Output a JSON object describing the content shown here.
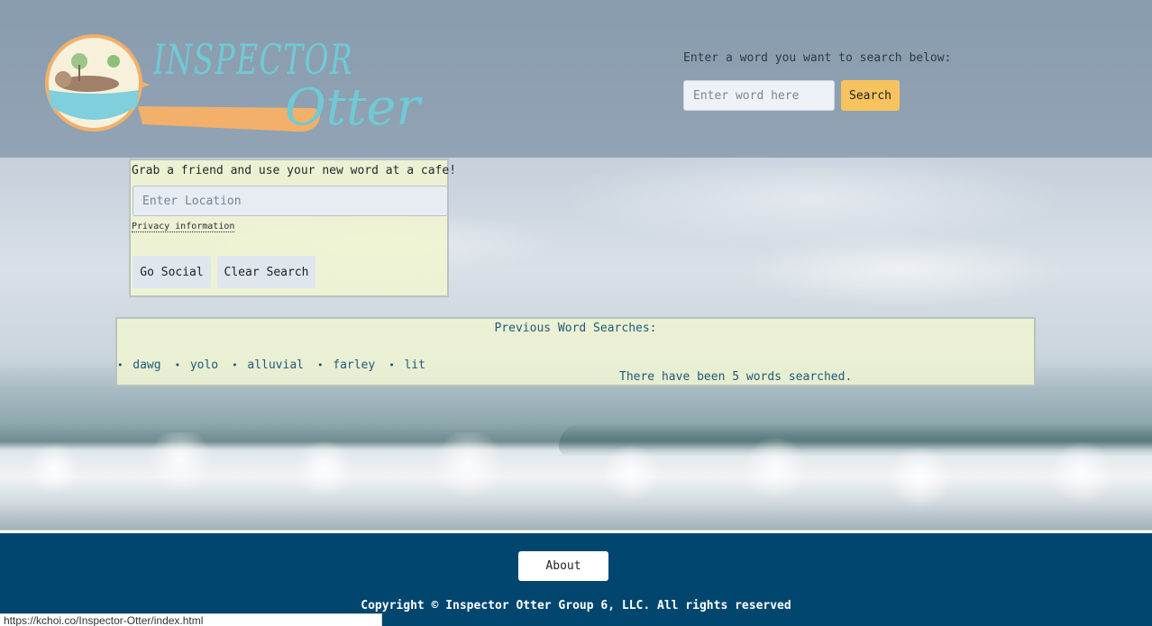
{
  "header": {
    "logo_text_top": "INSPECTOR",
    "logo_text_bottom": "Otter",
    "search_prompt": "Enter a word you want to search below:",
    "word_placeholder": "Enter word here",
    "search_label": "Search"
  },
  "social": {
    "title": "Grab a friend and use your new word at a cafe!",
    "location_placeholder": "Enter Location",
    "privacy_label": "Privacy information",
    "go_label": "Go Social",
    "clear_label": "Clear Search"
  },
  "previous": {
    "title": "Previous Word Searches:",
    "words": [
      "dawg",
      "yolo",
      "alluvial",
      "farley",
      "lit"
    ],
    "count_text": "There have been 5 words searched."
  },
  "footer": {
    "about_label": "About",
    "copyright": "Copyright © Inspector Otter Group 6, LLC. All rights reserved"
  },
  "status_bar": {
    "url": "https://kchoi.co/Inspector-Otter/index.html"
  },
  "colors": {
    "accent": "#f6c35e",
    "footer_bg": "#00466f",
    "logo_teal": "#6fcad6",
    "logo_orange": "#f2b06a",
    "link_text": "#1f5a78"
  },
  "icons": [
    "otter-magnifier-logo"
  ]
}
